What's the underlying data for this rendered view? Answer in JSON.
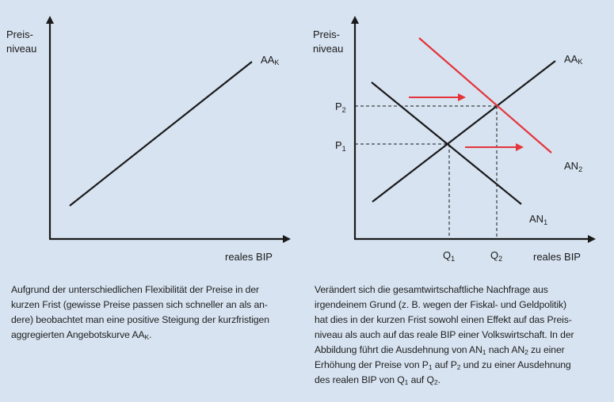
{
  "left_diagram": {
    "y_label_1": "Preis-",
    "y_label_2": "niveau",
    "x_label": "reales BIP",
    "curve_label": "AA",
    "curve_label_sub": "K"
  },
  "right_diagram": {
    "y_label_1": "Preis-",
    "y_label_2": "niveau",
    "x_label": "reales BIP",
    "supply_label": "AA",
    "supply_label_sub": "K",
    "demand1_label": "AN",
    "demand1_sub": "1",
    "demand2_label": "AN",
    "demand2_sub": "2",
    "p1": "P",
    "p1_sub": "1",
    "p2": "P",
    "p2_sub": "2",
    "q1": "Q",
    "q1_sub": "1",
    "q2": "Q",
    "q2_sub": "2"
  },
  "colors": {
    "background": "#d7e3f1",
    "line": "#1a1a1a",
    "shift": "#e5343a"
  },
  "left_caption": {
    "line1": "Aufgrund der unterschiedlichen Flexibilität der Preise in der",
    "line2": "kurzen Frist (gewisse Preise passen sich schneller an als an-",
    "line3": "dere) beobachtet man eine positive Steigung der kurzfristigen",
    "line4_pre": "aggregierten Angebotskurve AA",
    "line4_sub": "K",
    "line4_post": "."
  },
  "right_caption": {
    "line1": "Verändert sich die gesamtwirtschaftliche Nachfrage aus",
    "line2": "irgendeinem Grund (z. B. wegen der Fiskal- und Geldpolitik)",
    "line3": "hat dies in der kurzen Frist sowohl einen Effekt auf das Preis-",
    "line4": "niveau als auch auf das reale BIP einer Volkswirtschaft. In der",
    "line5_a": "Abbildung führt die Ausdehnung von AN",
    "line5_s1": "1",
    "line5_b": " nach AN",
    "line5_s2": "2",
    "line5_c": " zu einer",
    "line6_a": "Erhöhung der Preise von P",
    "line6_s1": "1",
    "line6_b": " auf P",
    "line6_s2": "2",
    "line6_c": " und zu einer Ausdehnung",
    "line7_a": "des realen BIP von Q",
    "line7_s1": "1",
    "line7_b": " auf Q",
    "line7_s2": "2",
    "line7_c": "."
  }
}
